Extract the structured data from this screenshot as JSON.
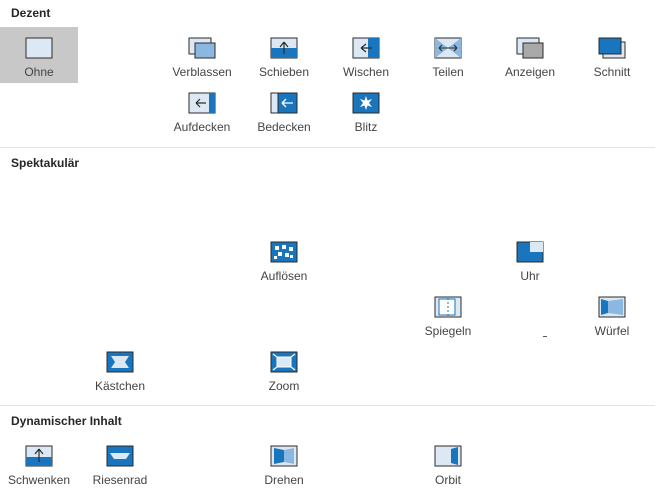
{
  "sections": [
    {
      "title": "Dezent",
      "items": [
        {
          "label": "Ohne",
          "icon": "none-transition-icon",
          "selected": true
        },
        {
          "label": "Verblassen",
          "icon": "fade-icon"
        },
        {
          "label": "Schieben",
          "icon": "push-icon"
        },
        {
          "label": "Wischen",
          "icon": "wipe-icon"
        },
        {
          "label": "Teilen",
          "icon": "split-icon"
        },
        {
          "label": "Anzeigen",
          "icon": "reveal-icon"
        },
        {
          "label": "Schnitt",
          "icon": "cut-icon"
        },
        {
          "label": "Aufdecken",
          "icon": "uncover-icon"
        },
        {
          "label": "Bedecken",
          "icon": "cover-icon"
        },
        {
          "label": "Blitz",
          "icon": "flash-icon"
        }
      ]
    },
    {
      "title": "Spektakulär",
      "items": [
        {
          "label": "Auflösen",
          "icon": "dissolve-icon"
        },
        {
          "label": "Uhr",
          "icon": "clock-icon"
        },
        {
          "label": "Spiegeln",
          "icon": "flip-icon"
        },
        {
          "label": "Würfel",
          "icon": "cube-icon"
        },
        {
          "label": "Kästchen",
          "icon": "box-icon"
        },
        {
          "label": "Zoom",
          "icon": "zoom-icon"
        }
      ]
    },
    {
      "title": "Dynamischer Inhalt",
      "items": [
        {
          "label": "Schwenken",
          "icon": "pan-icon"
        },
        {
          "label": "Riesenrad",
          "icon": "ferris-wheel-icon"
        },
        {
          "label": "Drehen",
          "icon": "rotate-icon"
        },
        {
          "label": "Orbit",
          "icon": "orbit-icon"
        }
      ]
    }
  ],
  "colors": {
    "icon_blue": "#1a75bf",
    "icon_light": "#dce9f5",
    "icon_border": "#2b2b2b",
    "selected_bg": "#c8c8c8"
  }
}
